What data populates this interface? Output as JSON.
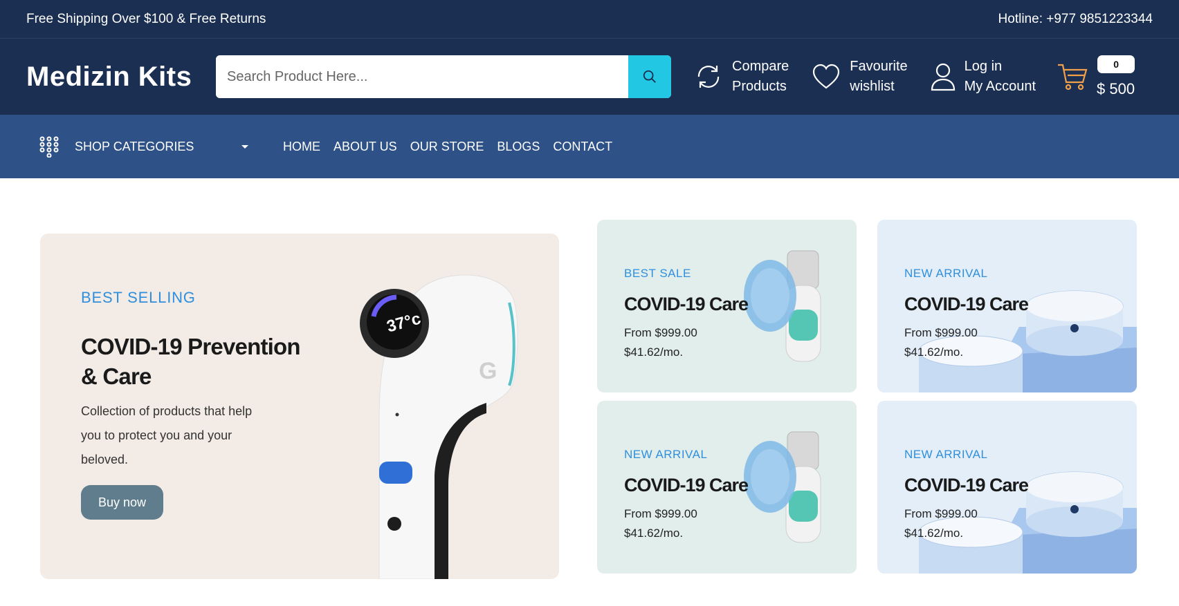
{
  "topbar": {
    "shipping": "Free Shipping Over $100 & Free Returns",
    "hotline": "Hotline: +977 9851223344"
  },
  "header": {
    "logo": "Medizin Kits",
    "search_placeholder": "Search Product Here...",
    "compare_line1": "Compare",
    "compare_line2": "Products",
    "favourite_line1": "Favourite",
    "favourite_line2": "wishlist",
    "login_line1": "Log in",
    "login_line2": "My Account",
    "cart_count": "0",
    "cart_total": "$ 500"
  },
  "nav": {
    "categories_label": "SHOP CATEGORIES",
    "menu": [
      "HOME",
      "ABOUT US",
      "OUR STORE",
      "BLOGS",
      "CONTACT"
    ]
  },
  "hero": {
    "tag": "BEST SELLING",
    "title": "COVID-19 Prevention & Care",
    "description": "Collection of products that help you to protect you and your beloved.",
    "button": "Buy now",
    "device_temp": "37°c"
  },
  "cards": [
    {
      "tag": "BEST SALE",
      "title": "COVID-19 Care",
      "price": "From $999.00",
      "monthly": "$41.62/mo."
    },
    {
      "tag": "NEW ARRIVAL",
      "title": "COVID-19 Care",
      "price": "From $999.00",
      "monthly": "$41.62/mo."
    },
    {
      "tag": "NEW ARRIVAL",
      "title": "COVID-19 Care",
      "price": "From $999.00",
      "monthly": "$41.62/mo."
    },
    {
      "tag": "NEW ARRIVAL",
      "title": "COVID-19 Care",
      "price": "From $999.00",
      "monthly": "$41.62/mo."
    }
  ],
  "colors": {
    "header_bg": "#1b2f52",
    "nav_bg": "#2e5288",
    "search_button": "#22c7e4",
    "accent_tag": "#2f8fdc",
    "cart_icon": "#f0a14a"
  }
}
